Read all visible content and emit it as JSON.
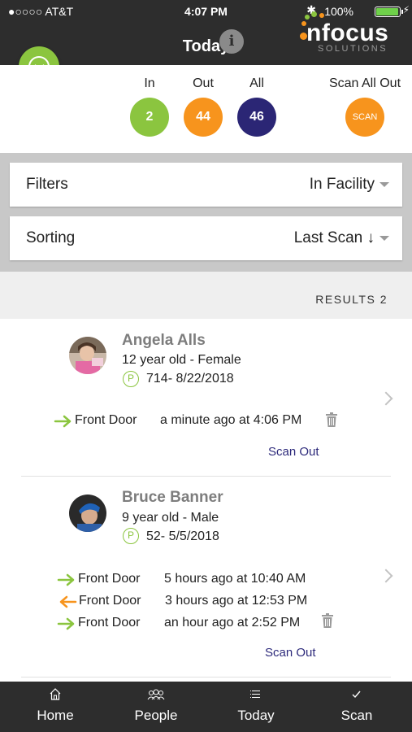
{
  "status_bar": {
    "carrier": "●○○○○ AT&T",
    "time": "4:07 PM",
    "battery_percent": "100%",
    "battery_level": 1.0
  },
  "header": {
    "title": "Today",
    "logo_text": "nfocus",
    "logo_sub": "SOLUTIONS"
  },
  "counts": {
    "in_label": "In",
    "in_value": "2",
    "out_label": "Out",
    "out_value": "44",
    "all_label": "All",
    "all_value": "46",
    "scan_all_label": "Scan All Out",
    "scan_button": "SCAN"
  },
  "colors": {
    "in": "#8bc53f",
    "out": "#f7941d",
    "all": "#2b2675",
    "scan": "#f7941d",
    "link": "#2d2a7b"
  },
  "filters": {
    "label": "Filters",
    "value": "In Facility"
  },
  "sorting": {
    "label": "Sorting",
    "value": "Last Scan ↓"
  },
  "results": {
    "text": "RESULTS 2"
  },
  "people": [
    {
      "name": "Angela Alls",
      "details": "12 year old - Female",
      "parking": "714- 8/22/2018",
      "scans": [
        {
          "direction": "in",
          "door": "Front Door",
          "when": "a minute ago at 4:06 PM"
        }
      ],
      "scan_out": "Scan Out"
    },
    {
      "name": "Bruce Banner",
      "details": "9 year old - Male",
      "parking": "52- 5/5/2018",
      "scans": [
        {
          "direction": "in",
          "door": "Front Door",
          "when": "5 hours ago at 10:40 AM"
        },
        {
          "direction": "out",
          "door": "Front Door",
          "when": "3 hours ago at 12:53 PM"
        },
        {
          "direction": "in",
          "door": "Front Door",
          "when": "an hour ago at 2:52 PM"
        }
      ],
      "scan_out": "Scan Out"
    }
  ],
  "tabs": [
    {
      "label": "Home",
      "icon": "home-icon"
    },
    {
      "label": "People",
      "icon": "people-icon"
    },
    {
      "label": "Today",
      "icon": "list-icon"
    },
    {
      "label": "Scan",
      "icon": "check-icon"
    }
  ]
}
